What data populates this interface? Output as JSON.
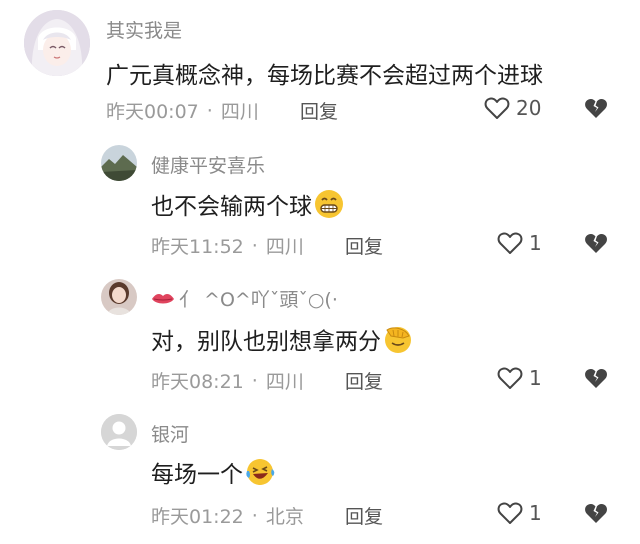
{
  "comments": [
    {
      "username": "其实我是",
      "content": "广元真概念神，每场比赛不会超过两个进球",
      "time": "昨天00:07",
      "location": "四川",
      "reply_label": "回复",
      "likes": "20"
    },
    {
      "username": "健康平安喜乐",
      "content": "也不会输两个球",
      "emoji": "grinning-face-icon",
      "time": "昨天11:52",
      "location": "四川",
      "reply_label": "回复",
      "likes": "1"
    },
    {
      "username": "亻 ^O^吖ˇ頭ˇ○(·",
      "content": "对，别队也别想拿两分",
      "emoji": "face-palm-icon",
      "time": "昨天08:21",
      "location": "四川",
      "reply_label": "回复",
      "likes": "1"
    },
    {
      "username": "银河",
      "content": "每场一个",
      "emoji": "laughing-tears-icon",
      "time": "昨天01:22",
      "location": "北京",
      "reply_label": "回复",
      "likes": "1"
    }
  ],
  "colors": {
    "text_primary": "#1f1f1f",
    "text_secondary": "#9a9a9a",
    "icon": "#444444",
    "emoji_yellow": "#f7c531"
  }
}
